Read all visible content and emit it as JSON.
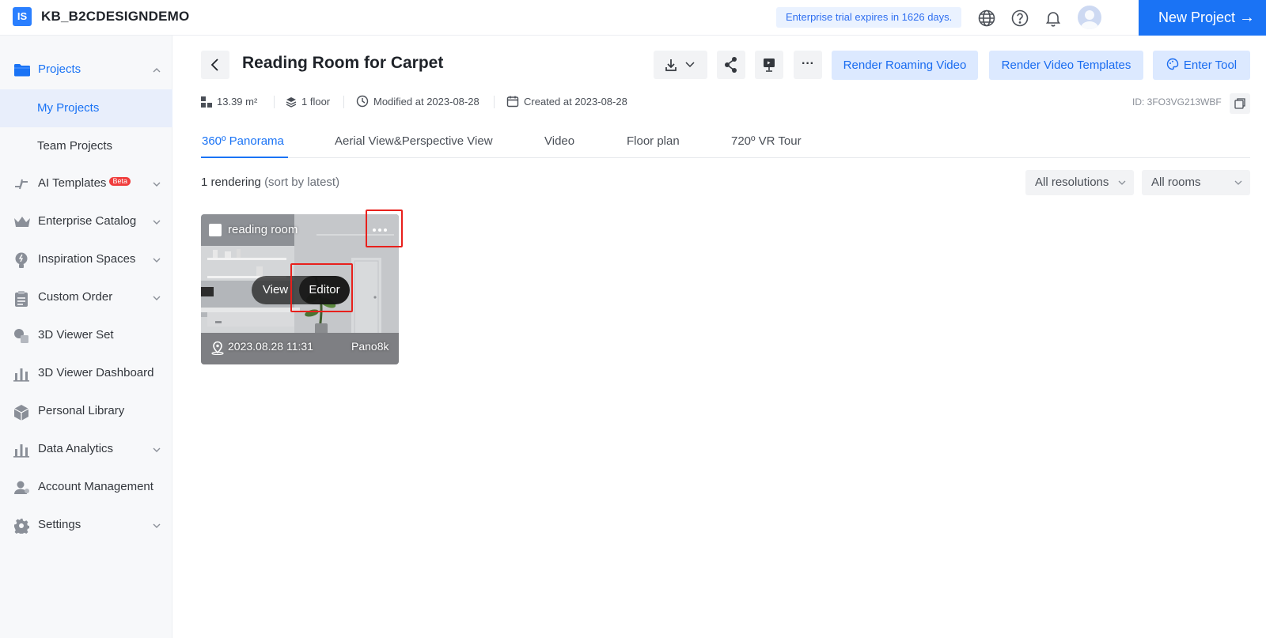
{
  "header": {
    "logo_text": "IS",
    "brand": "KB_B2CDESIGNDEMO",
    "trial_notice": "Enterprise trial expires in 1626 days.",
    "new_project_label": "New Project",
    "new_project_arrow": "→"
  },
  "sidebar": {
    "projects": "Projects",
    "my_projects": "My Projects",
    "team_projects": "Team Projects",
    "ai_templates": "AI Templates",
    "beta": "Beta",
    "enterprise_catalog": "Enterprise Catalog",
    "inspiration_spaces": "Inspiration Spaces",
    "custom_order": "Custom Order",
    "viewer_set": "3D Viewer Set",
    "viewer_dashboard": "3D Viewer Dashboard",
    "personal_library": "Personal Library",
    "data_analytics": "Data Analytics",
    "account_management": "Account Management",
    "settings": "Settings"
  },
  "project": {
    "title": "Reading Room for Carpet",
    "area": "13.39 m²",
    "floors": "1 floor",
    "modified": "Modified at 2023-08-28",
    "created": "Created at 2023-08-28",
    "id": "ID: 3FO3VG213WBF"
  },
  "actions": {
    "render_roaming_video": "Render Roaming Video",
    "render_video_templates": "Render Video Templates",
    "enter_tool": "Enter Tool",
    "more": "···"
  },
  "tabs": [
    {
      "label": "360º Panorama"
    },
    {
      "label": "Aerial View&Perspective View"
    },
    {
      "label": "Video"
    },
    {
      "label": "Floor plan"
    },
    {
      "label": "720º VR Tour"
    }
  ],
  "list": {
    "count": "1 rendering",
    "sort": "(sort by latest)"
  },
  "filters": {
    "resolution": "All resolutions",
    "rooms": "All rooms"
  },
  "card": {
    "name": "reading room",
    "view": "View",
    "editor": "Editor",
    "date": "2023.08.28 11:31",
    "resolution": "Pano8k",
    "more": "···"
  },
  "colors": {
    "accent": "#1a73f5",
    "action_bg": "#dce9ff",
    "highlight": "#e8201c"
  }
}
